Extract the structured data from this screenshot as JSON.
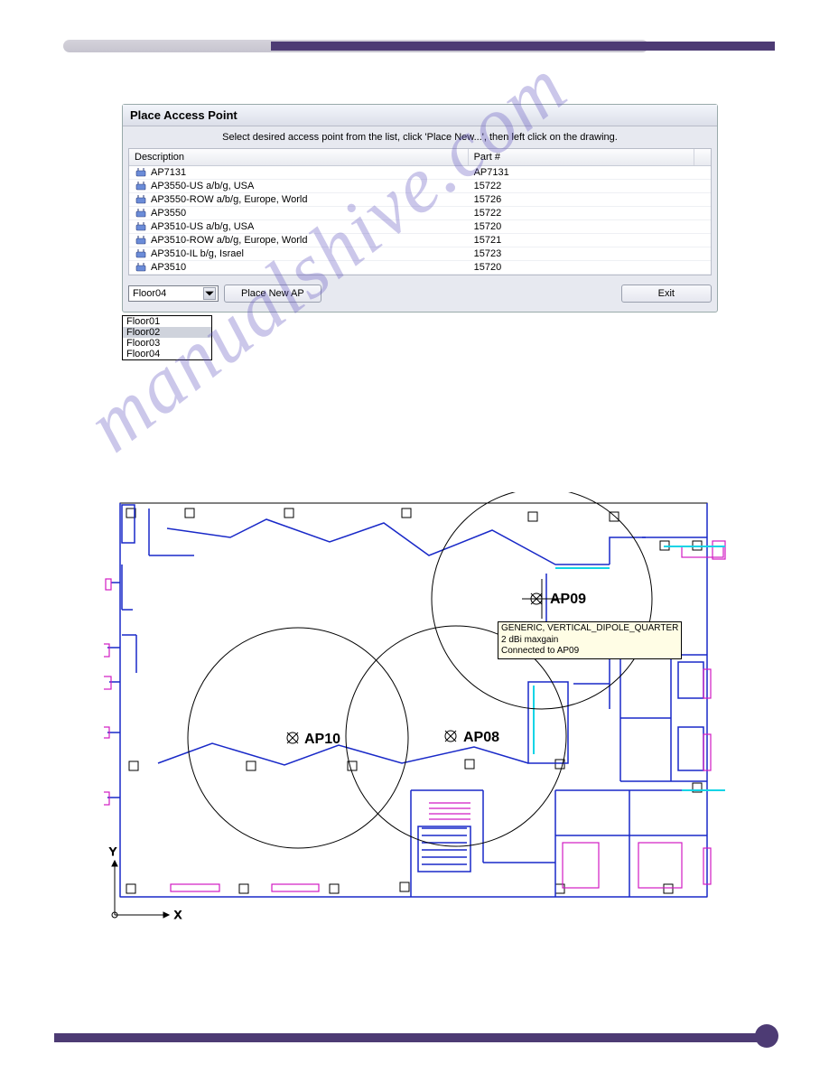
{
  "dialog": {
    "title": "Place Access Point",
    "hint": "Select desired access point from the list, click 'Place New...', then left click on the drawing.",
    "columns": {
      "desc": "Description",
      "part": "Part #"
    },
    "rows": [
      {
        "desc": "AP7131",
        "part": "AP7131"
      },
      {
        "desc": "AP3550-US a/b/g, USA",
        "part": "15722"
      },
      {
        "desc": "AP3550-ROW a/b/g, Europe, World",
        "part": "15726"
      },
      {
        "desc": "AP3550",
        "part": "15722"
      },
      {
        "desc": "AP3510-US a/b/g, USA",
        "part": "15720"
      },
      {
        "desc": "AP3510-ROW a/b/g, Europe, World",
        "part": "15721"
      },
      {
        "desc": "AP3510-IL b/g, Israel",
        "part": "15723"
      },
      {
        "desc": "AP3510",
        "part": "15720"
      }
    ],
    "combo_value": "Floor04",
    "place_btn": "Place New AP",
    "exit_btn": "Exit"
  },
  "dropdown": {
    "options": [
      "Floor01",
      "Floor02",
      "Floor03",
      "Floor04"
    ],
    "highlighted_index": 1
  },
  "watermark": "manualshive.com",
  "floorplan": {
    "axis_x": "X",
    "axis_y": "Y",
    "ap_labels": {
      "ap08": "AP08",
      "ap09": "AP09",
      "ap10": "AP10"
    },
    "tooltip": {
      "line1": "GENERIC, VERTICAL_DIPOLE_QUARTER",
      "line2": "2 dBi maxgain",
      "line3": "Connected to AP09"
    }
  }
}
